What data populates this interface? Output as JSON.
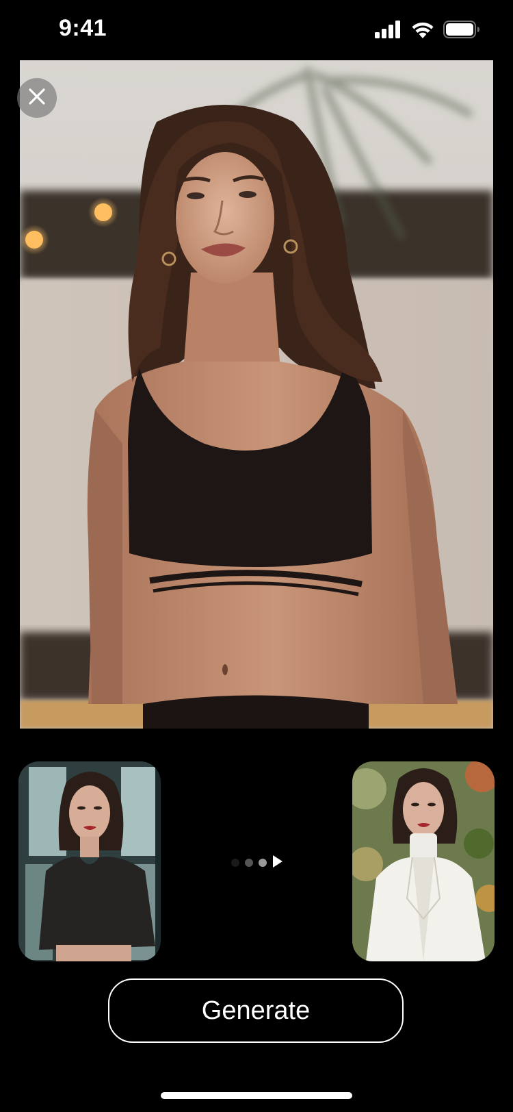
{
  "status_bar": {
    "time": "9:41",
    "icons": [
      "cellular-signal-icon",
      "wifi-icon",
      "battery-icon"
    ]
  },
  "main_photo": {
    "description_icon": "portrait-photo",
    "close_icon": "close-icon"
  },
  "thumbnails": {
    "source": {
      "icon": "portrait-photo-black-top"
    },
    "target": {
      "icon": "portrait-photo-white-blazer"
    }
  },
  "transition": {
    "icon": "play-arrow-icon"
  },
  "actions": {
    "generate_label": "Generate"
  },
  "colors": {
    "background": "#000000",
    "foreground": "#ffffff",
    "close_button_bg": "#787878"
  }
}
